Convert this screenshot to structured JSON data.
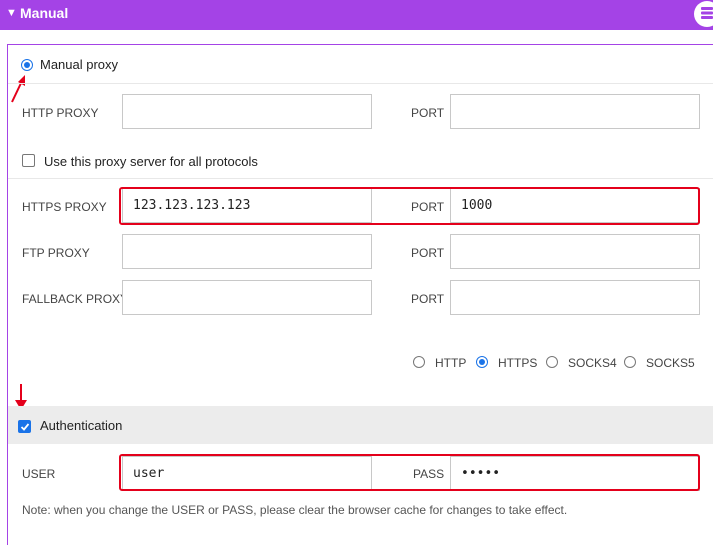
{
  "header": {
    "title": "Manual",
    "chevron": "▼",
    "logo_icon": "server-stack-icon"
  },
  "mode": {
    "label": "Manual proxy",
    "selected": true
  },
  "http": {
    "label": "HTTP PROXY",
    "port_label": "PORT",
    "value": "",
    "port": ""
  },
  "all_protocols": {
    "label": "Use this proxy server for all protocols",
    "checked": false
  },
  "https": {
    "label": "HTTPS PROXY",
    "port_label": "PORT",
    "value": "123.123.123.123",
    "port": "1000"
  },
  "ftp": {
    "label": "FTP PROXY",
    "port_label": "PORT",
    "value": "",
    "port": ""
  },
  "fallback": {
    "label": "FALLBACK PROXY",
    "port_label": "PORT",
    "value": "",
    "port": ""
  },
  "protocol_options": {
    "options": [
      "HTTP",
      "HTTPS",
      "SOCKS4",
      "SOCKS5"
    ],
    "selected": "HTTPS"
  },
  "auth": {
    "label": "Authentication",
    "checked": true,
    "user_label": "USER",
    "user_value": "user",
    "pass_label": "PASS",
    "pass_value": "•••••"
  },
  "note": "Note: when you change the USER or PASS, please clear the browser cache for changes to take effect.",
  "colors": {
    "accent": "#a443e6",
    "highlight": "#e4001b",
    "radio_checked": "#1a73e8",
    "annotation_arrow": "#e4001b"
  }
}
